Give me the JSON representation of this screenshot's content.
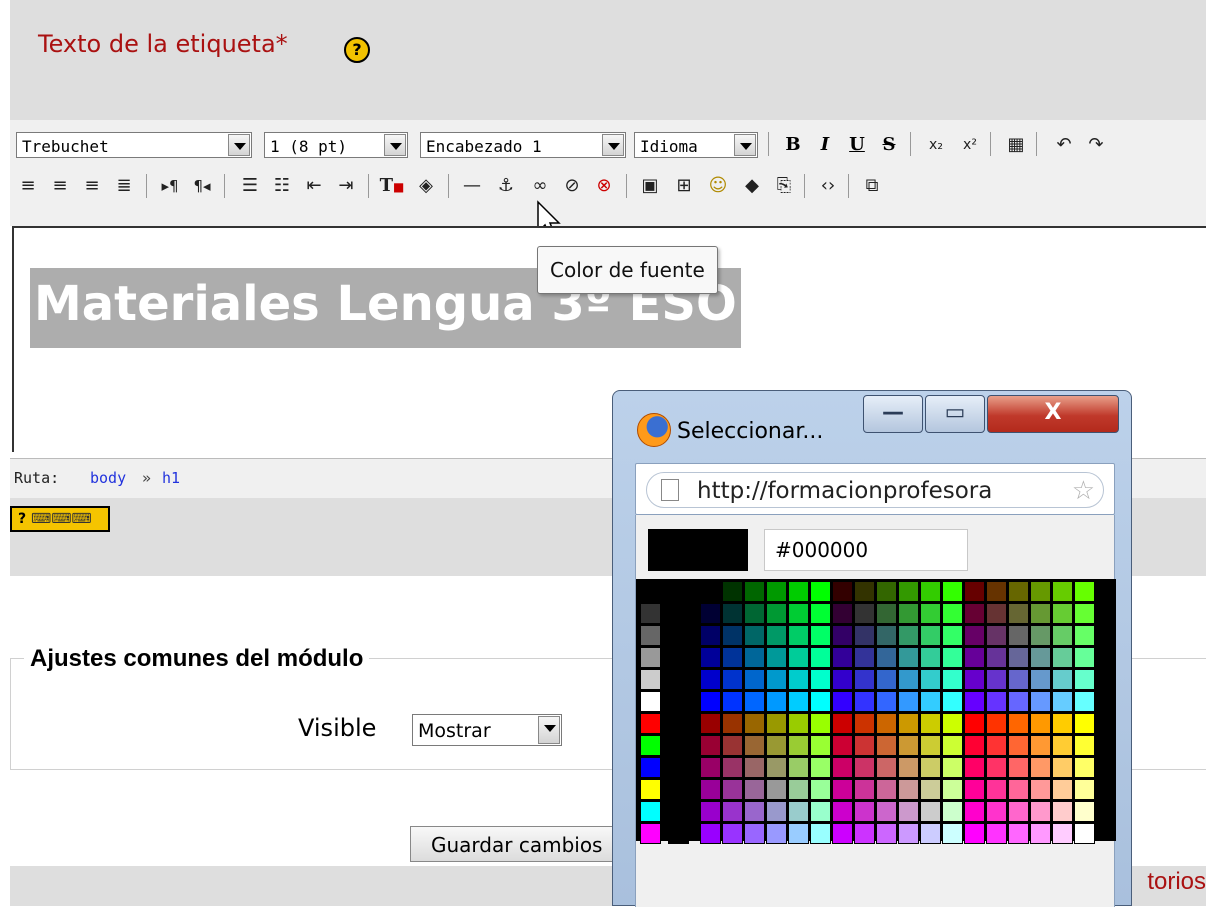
{
  "field": {
    "title": "Texto de la etiqueta*",
    "help_glyph": "?"
  },
  "toolbar": {
    "font_family": "Trebuchet",
    "font_size": "1 (8 pt)",
    "heading": "Encabezado 1",
    "language": "Idioma",
    "bold": "B",
    "italic": "I",
    "underline": "U",
    "strike": "S"
  },
  "editor": {
    "content_heading": "Materiales Lengua 3º ESO"
  },
  "tooltip": {
    "text": "Color de fuente"
  },
  "path": {
    "label": "Ruta:",
    "items": [
      "body",
      "h1"
    ],
    "separator": "»"
  },
  "module_settings": {
    "legend": "Ajustes comunes del módulo",
    "visible_label": "Visible",
    "visible_value": "Mostrar"
  },
  "actions": {
    "save_label": "Guardar cambios",
    "footer_text": "torios"
  },
  "popup": {
    "title": "Seleccionar...",
    "url": "http://formacionprofesora",
    "hex_value": "#000000",
    "selected_color": "#000000"
  },
  "colors": {
    "accent_red": "#aa1111",
    "link_blue": "#2233dd",
    "help_yellow": "#f2c200"
  },
  "icons": [
    "help-icon",
    "font-color-icon",
    "background-color-icon",
    "horizontal-rule-icon",
    "anchor-icon",
    "link-icon",
    "unlink-icon",
    "nolink-icon",
    "image-icon",
    "table-icon",
    "smiley-icon",
    "insert-media-icon",
    "search-replace-icon",
    "html-source-icon",
    "fullscreen-icon",
    "firefox-icon",
    "page-icon",
    "star-icon",
    "minimize-icon",
    "maximize-icon",
    "close-icon"
  ]
}
